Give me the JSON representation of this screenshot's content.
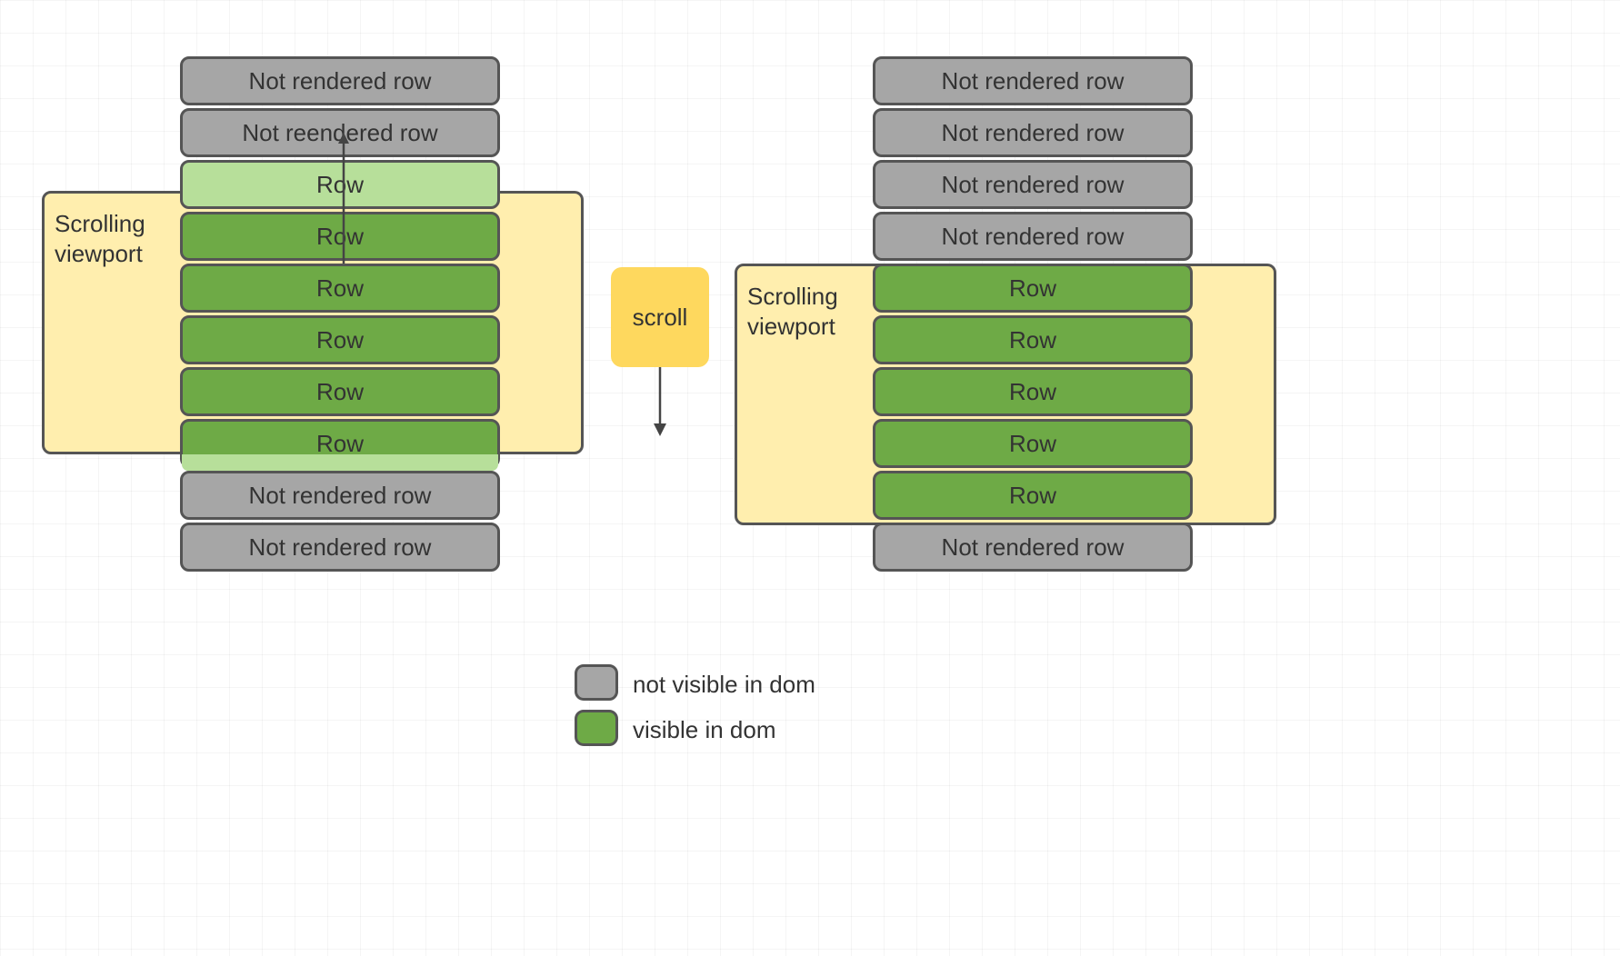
{
  "left": {
    "viewport_label": "Scrolling\nviewport",
    "rows": [
      "Not rendered row",
      "Not reendered row",
      "Row",
      "Row",
      "Row",
      "Row",
      "Row",
      "Row",
      "Not rendered row",
      "Not rendered row"
    ]
  },
  "right": {
    "viewport_label": "Scrolling\nviewport",
    "rows": [
      "Not rendered row",
      "Not rendered row",
      "Not rendered row",
      "Not rendered row",
      "Row",
      "Row",
      "Row",
      "Row",
      "Row",
      "Not rendered row"
    ]
  },
  "scroll_label": "scroll",
  "legend": {
    "not_visible": "not visible in dom",
    "visible": "visible in dom"
  },
  "colors": {
    "gray": "#a6a6a6",
    "green": "#6eaa46",
    "lightgreen": "#b7df9a",
    "viewport": "#ffeeae",
    "scroll_tag": "#fed85e"
  }
}
